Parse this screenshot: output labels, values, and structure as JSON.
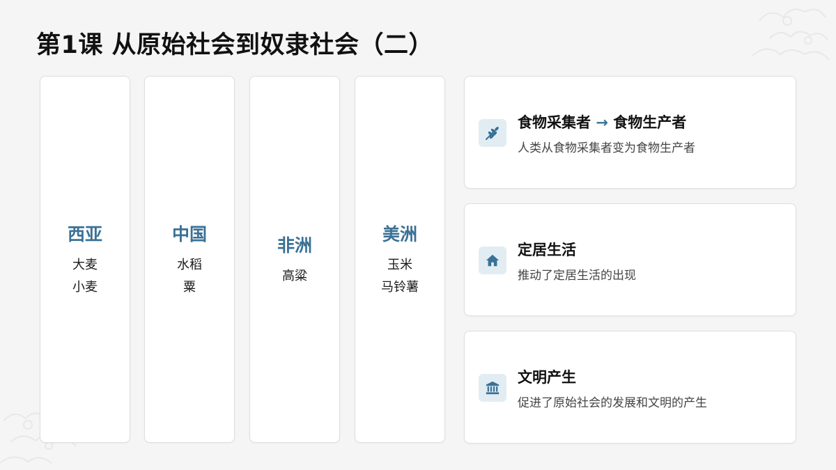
{
  "title": "第1课 从原始社会到奴隶社会（二）",
  "regions": [
    {
      "name": "西亚",
      "crops": [
        "大麦",
        "小麦"
      ]
    },
    {
      "name": "中国",
      "crops": [
        "水稻",
        "粟"
      ]
    },
    {
      "name": "非洲",
      "crops": [
        "高粱"
      ]
    },
    {
      "name": "美洲",
      "crops": [
        "玉米",
        "马铃薯"
      ]
    }
  ],
  "features": [
    {
      "icon": "wheat-icon",
      "title_left": "食物采集者",
      "arrow": "→",
      "title_right": "食物生产者",
      "desc": "人类从食物采集者变为食物生产者"
    },
    {
      "icon": "house-icon",
      "title": "定居生活",
      "desc": "推动了定居生活的出现"
    },
    {
      "icon": "institution-icon",
      "title": "文明产生",
      "desc": "促进了原始社会的发展和文明的产生"
    }
  ],
  "colors": {
    "accent": "#3a7196",
    "icon_bg": "#e2edf3",
    "background": "#f5f5f5"
  }
}
